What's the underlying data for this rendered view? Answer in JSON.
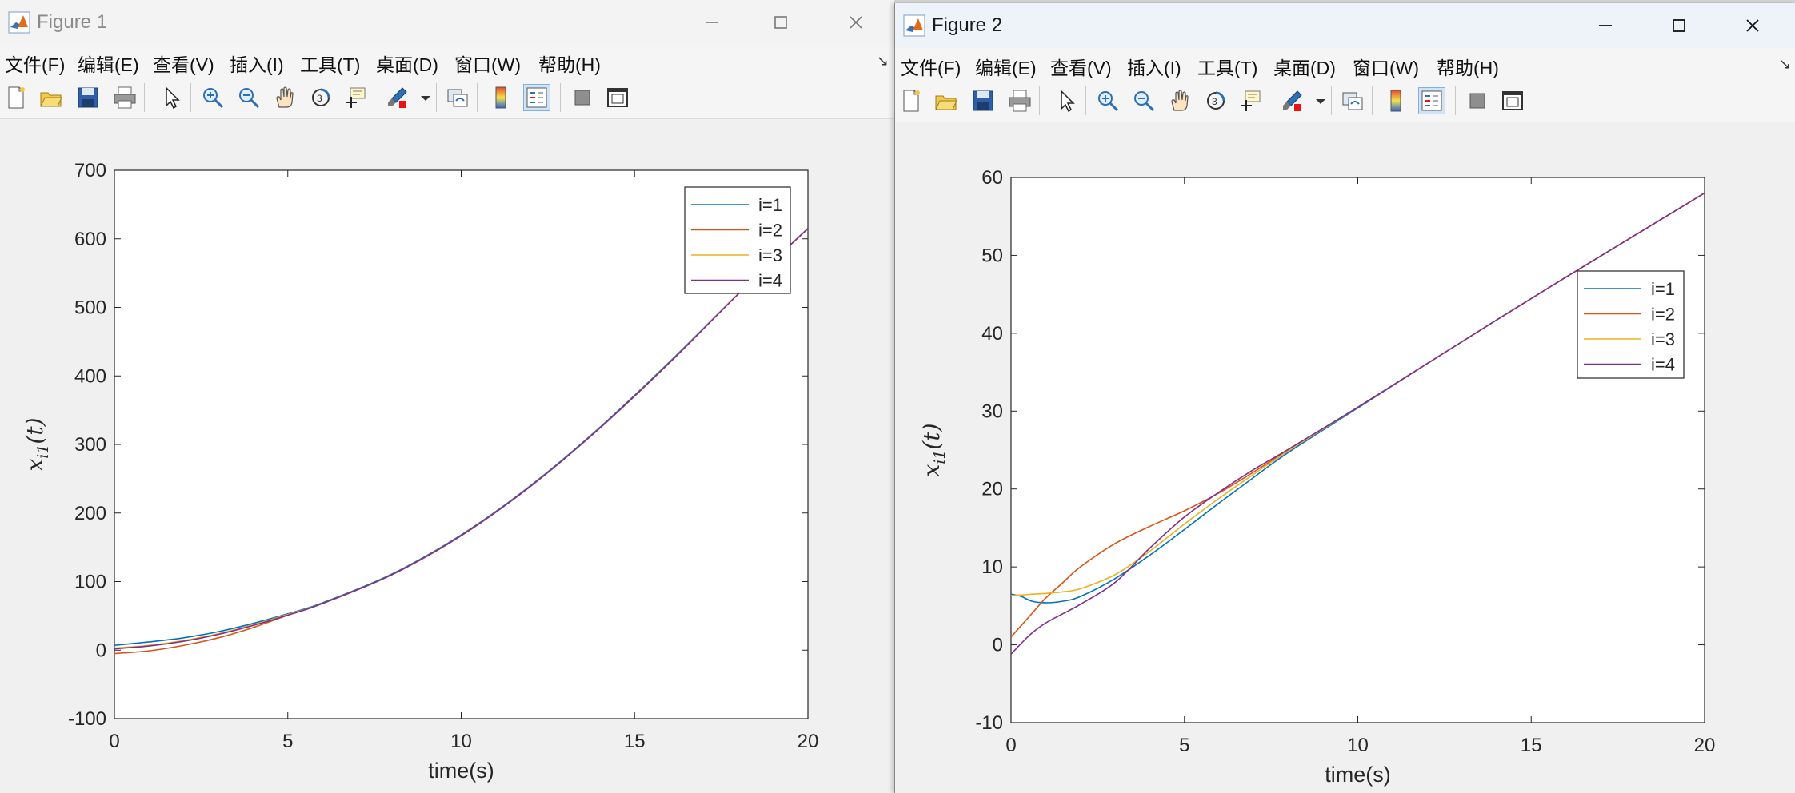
{
  "windows": [
    {
      "title": "Figure 1",
      "menu": [
        "文件(F)",
        "编辑(E)",
        "查看(V)",
        "插入(I)",
        "工具(T)",
        "桌面(D)",
        "窗口(W)",
        "帮助(H)"
      ]
    },
    {
      "title": "Figure 2",
      "menu": [
        "文件(F)",
        "编辑(E)",
        "查看(V)",
        "插入(I)",
        "工具(T)",
        "桌面(D)",
        "窗口(W)",
        "帮助(H)"
      ]
    }
  ],
  "toolbar_icons": [
    "new-figure-icon",
    "open-file-icon",
    "save-icon",
    "print-icon",
    "select-pointer-icon",
    "zoom-in-icon",
    "zoom-out-icon",
    "pan-hand-icon",
    "rotate-3d-icon",
    "data-cursor-icon",
    "brush-icon",
    "brush-dropdown-icon",
    "link-plot-icon",
    "colorbar-icon",
    "legend-icon",
    "hide-plot-tools-icon",
    "show-plot-tools-icon"
  ],
  "colors": {
    "series": [
      "#0072BD",
      "#D95319",
      "#EDB120",
      "#7E2F8E"
    ]
  },
  "chart_data": [
    {
      "type": "line",
      "xlabel": "time(s)",
      "ylabel": "x_{i1}(t)",
      "xlim": [
        0,
        20
      ],
      "ylim": [
        -100,
        700
      ],
      "xticks": [
        "0",
        "5",
        "10",
        "15",
        "20"
      ],
      "yticks": [
        "-100",
        "0",
        "100",
        "200",
        "300",
        "400",
        "500",
        "600",
        "700"
      ],
      "legend_position": "top-right",
      "x": [
        0,
        1,
        2,
        3,
        4,
        5,
        6,
        8,
        10,
        12,
        14,
        16,
        18,
        20
      ],
      "series": [
        {
          "name": "i=1",
          "values": [
            7,
            12,
            18,
            27,
            39,
            53,
            69,
            111,
            168,
            240,
            325,
            420,
            520,
            615
          ]
        },
        {
          "name": "i=2",
          "values": [
            -5,
            -1,
            7,
            18,
            33,
            51,
            68,
            110,
            167,
            239,
            324,
            419,
            520,
            615
          ]
        },
        {
          "name": "i=3",
          "values": [
            3,
            7,
            14,
            24,
            37,
            52,
            68,
            110,
            167,
            239,
            324,
            419,
            520,
            615
          ]
        },
        {
          "name": "i=4",
          "values": [
            2,
            6,
            13,
            23,
            36,
            51,
            68,
            110,
            167,
            239,
            324,
            419,
            520,
            615
          ]
        }
      ]
    },
    {
      "type": "line",
      "xlabel": "time(s)",
      "ylabel": "x_{i1}(t)",
      "xlim": [
        0,
        20
      ],
      "ylim": [
        -10,
        60
      ],
      "xticks": [
        "0",
        "5",
        "10",
        "15",
        "20"
      ],
      "yticks": [
        "-10",
        "0",
        "10",
        "20",
        "30",
        "40",
        "50",
        "60"
      ],
      "legend_position": "right",
      "x": [
        0,
        0.3,
        0.6,
        1,
        1.5,
        2,
        3,
        4,
        5,
        6,
        7,
        8,
        10,
        12,
        14,
        16,
        18,
        20
      ],
      "series": [
        {
          "name": "i=1",
          "values": [
            6.5,
            6.2,
            5.6,
            5.4,
            5.6,
            6.2,
            8.5,
            11.5,
            14.8,
            18.2,
            21.5,
            24.7,
            30.4,
            36.1,
            41.7,
            47.2,
            52.6,
            58.0
          ]
        },
        {
          "name": "i=2",
          "values": [
            1.0,
            2.5,
            4.0,
            6.0,
            8.0,
            10.0,
            13.0,
            15.2,
            17.2,
            19.5,
            22.2,
            25.0,
            30.5,
            36.1,
            41.7,
            47.2,
            52.6,
            58.0
          ]
        },
        {
          "name": "i=3",
          "values": [
            6.3,
            6.4,
            6.5,
            6.6,
            6.8,
            7.2,
            9.0,
            12.0,
            15.5,
            18.8,
            21.9,
            24.9,
            30.5,
            36.1,
            41.7,
            47.2,
            52.6,
            58.0
          ]
        },
        {
          "name": "i=4",
          "values": [
            -1.2,
            0.2,
            1.5,
            2.8,
            4.0,
            5.2,
            8.0,
            12.4,
            16.4,
            19.6,
            22.5,
            25.1,
            30.5,
            36.1,
            41.7,
            47.2,
            52.6,
            58.0
          ]
        }
      ]
    }
  ]
}
